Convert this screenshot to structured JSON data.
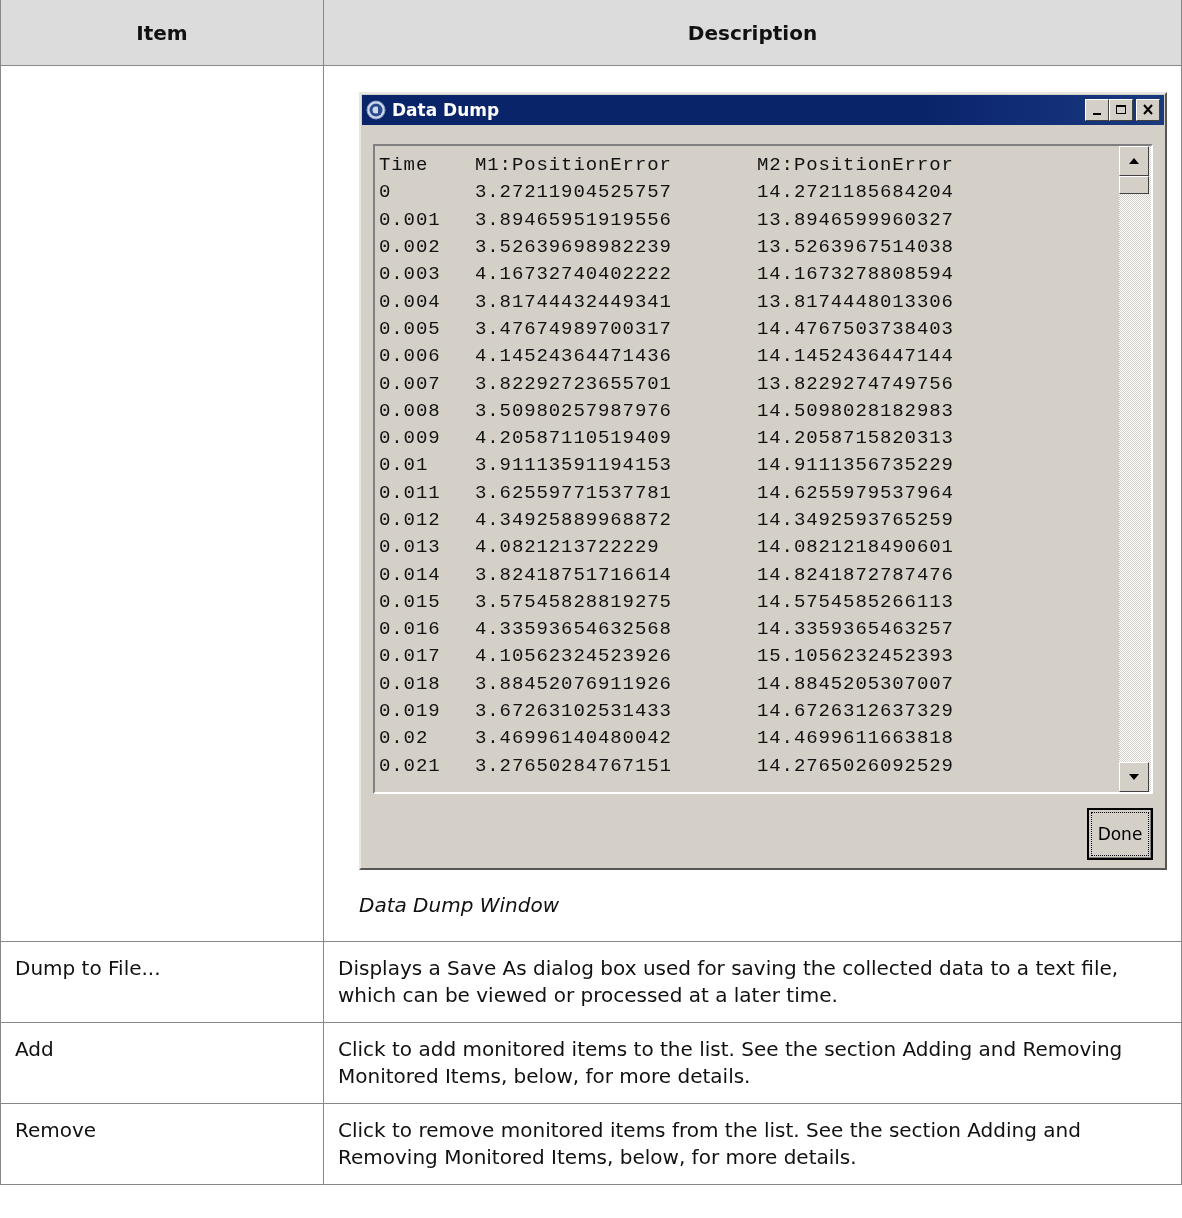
{
  "table": {
    "columns": [
      "Item",
      "Description"
    ],
    "rows": [
      {
        "kind": "figure",
        "window": {
          "title": "Data Dump",
          "list": {
            "columns": [
              "Time",
              "M1:PositionError",
              "M2:PositionError"
            ],
            "rows": [
              [
                "0",
                "3.27211904525757",
                "14.2721185684204"
              ],
              [
                "0.001",
                "3.89465951919556",
                "13.8946599960327"
              ],
              [
                "0.002",
                "3.52639698982239",
                "13.5263967514038"
              ],
              [
                "0.003",
                "4.16732740402222",
                "14.1673278808594"
              ],
              [
                "0.004",
                "3.81744432449341",
                "13.8174448013306"
              ],
              [
                "0.005",
                "3.47674989700317",
                "14.4767503738403"
              ],
              [
                "0.006",
                "4.14524364471436",
                "14.1452436447144"
              ],
              [
                "0.007",
                "3.82292723655701",
                "13.8229274749756"
              ],
              [
                "0.008",
                "3.50980257987976",
                "14.5098028182983"
              ],
              [
                "0.009",
                "4.20587110519409",
                "14.2058715820313"
              ],
              [
                "0.01",
                "3.91113591194153",
                "14.9111356735229"
              ],
              [
                "0.011",
                "3.62559771537781",
                "14.6255979537964"
              ],
              [
                "0.012",
                "4.34925889968872",
                "14.3492593765259"
              ],
              [
                "0.013",
                "4.0821213722229",
                "14.0821218490601"
              ],
              [
                "0.014",
                "3.82418751716614",
                "14.8241872787476"
              ],
              [
                "0.015",
                "3.57545828819275",
                "14.5754585266113"
              ],
              [
                "0.016",
                "4.33593654632568",
                "14.3359365463257"
              ],
              [
                "0.017",
                "4.10562324523926",
                "15.1056232452393"
              ],
              [
                "0.018",
                "3.88452076911926",
                "14.8845205307007"
              ],
              [
                "0.019",
                "3.67263102531433",
                "14.6726312637329"
              ],
              [
                "0.02",
                "3.46996140480042",
                "14.4699611663818"
              ],
              [
                "0.021",
                "3.27650284767151",
                "14.2765026092529"
              ]
            ]
          },
          "buttons": [
            {
              "label": "Done",
              "focused": true
            }
          ]
        },
        "caption": "Data Dump Window"
      },
      {
        "kind": "text",
        "item": "Dump to File...",
        "description": "Displays a Save As dialog box used for saving the collected data to a text file, which can be viewed or processed at a later time."
      },
      {
        "kind": "text",
        "item": "Add",
        "description": "Click to add monitored items to the list. See the section Adding and Removing Monitored Items, below, for more details."
      },
      {
        "kind": "text",
        "item": "Remove",
        "description": "Click to remove monitored items from the list. See the section Adding and Removing Monitored Items, below, for more details."
      }
    ]
  }
}
